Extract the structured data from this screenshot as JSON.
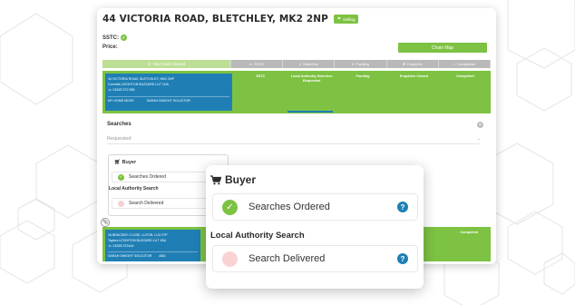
{
  "header": {
    "address": "44 VICTORIA ROAD, BLETCHLEY, MK2 2NP",
    "badge": "Selling",
    "sstc_label": "SSTC:",
    "price_label": "Price:",
    "chain_map_button": "Chain Map"
  },
  "stages": {
    "first": "Top Chain Closed",
    "items": [
      "SSTC",
      "Searches",
      "Funding",
      "Enquiries",
      "Completion"
    ]
  },
  "property1": {
    "address": "44 VICTORIA ROAD, BLETCHLEY, MK2 2NP",
    "agent": "Connells LEIGHTON BUZZARD LU7 1HA",
    "phone": "01525 372 555",
    "contact_left": "MY HOME MOVE",
    "contact_right": "SARAH DWIGHT SOLICITOR",
    "columns": [
      "SSTC",
      "Local Authority Searches Requested",
      "Funding",
      "Enquiries Closed",
      "Completed"
    ]
  },
  "searches": {
    "title": "Searches",
    "dropdown_value": "Requested"
  },
  "mini_panel": {
    "buyer_label": "Buyer",
    "item1": "Searches Ordered",
    "section": "Local Authority Search",
    "item2": "Search Delivered"
  },
  "property2": {
    "address": "16 BRACEBY CLOSE, LUTON, LU3 2TP",
    "agent": "Taylors LEIGHTON BUZZARD LU7 1BA",
    "phone": "01525 372444",
    "contact_left": "SARAH DWIGHT SOLICITOR",
    "contact_right": "ABG",
    "status": "Completed"
  },
  "zoom_panel": {
    "buyer_label": "Buyer",
    "item1": "Searches Ordered",
    "section": "Local Authority Search",
    "item2": "Search Delivered",
    "help_glyph": "?"
  },
  "colors": {
    "green": "#7dc242",
    "blue": "#1f7fb5",
    "pink": "#f9d3d3"
  }
}
